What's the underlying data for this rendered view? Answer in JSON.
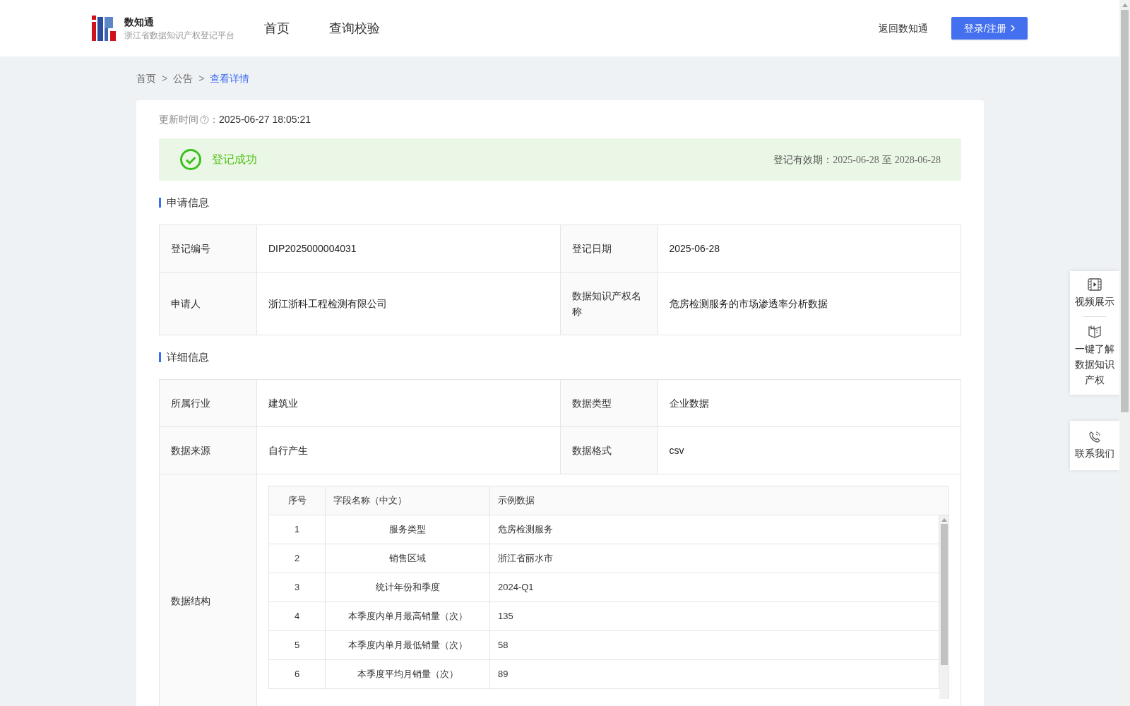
{
  "header": {
    "logo_title": "数知通",
    "logo_subtitle": "浙江省数据知识产权登记平台",
    "nav": [
      {
        "label": "首页"
      },
      {
        "label": "查询校验"
      }
    ],
    "back_link": "返回数知通",
    "login_button": "登录/注册"
  },
  "breadcrumb": [
    {
      "label": "首页",
      "current": false
    },
    {
      "label": "公告",
      "current": false
    },
    {
      "label": "查看详情",
      "current": true
    }
  ],
  "breadcrumb_separator": ">",
  "update": {
    "label": "更新时间",
    "colon": "：",
    "value": "2025-06-27 18:05:21"
  },
  "status": {
    "text": "登记成功",
    "validity_label": "登记有效期：",
    "validity_from": "2025-06-28",
    "validity_sep": "至",
    "validity_to": "2028-06-28"
  },
  "sections": [
    {
      "title": "申请信息",
      "rows": [
        {
          "kind": "pairs",
          "cells": [
            {
              "label": "登记编号",
              "value": "DIP2025000004031"
            },
            {
              "label": "登记日期",
              "value": "2025-06-28"
            }
          ]
        },
        {
          "kind": "pairs",
          "cells": [
            {
              "label": "申请人",
              "value": "浙江浙科工程检测有限公司"
            },
            {
              "label": "数据知识产权名称",
              "value": "危房检测服务的市场渗透率分析数据"
            }
          ]
        }
      ]
    },
    {
      "title": "详细信息",
      "rows": [
        {
          "kind": "pairs",
          "cells": [
            {
              "label": "所属行业",
              "value": "建筑业"
            },
            {
              "label": "数据类型",
              "value": "企业数据"
            }
          ]
        },
        {
          "kind": "pairs",
          "cells": [
            {
              "label": "数据来源",
              "value": "自行产生"
            },
            {
              "label": "数据格式",
              "value": "csv"
            }
          ]
        },
        {
          "kind": "structure",
          "label": "数据结构",
          "columns": [
            "序号",
            "字段名称（中文）",
            "示例数据"
          ],
          "rows": [
            [
              "1",
              "服务类型",
              "危房检测服务"
            ],
            [
              "2",
              "销售区域",
              "浙江省丽水市"
            ],
            [
              "3",
              "统计年份和季度",
              "2024-Q1"
            ],
            [
              "4",
              "本季度内单月最高销量（次）",
              "135"
            ],
            [
              "5",
              "本季度内单月最低销量（次）",
              "58"
            ],
            [
              "6",
              "本季度平均月销量（次）",
              "89"
            ]
          ]
        }
      ]
    }
  ],
  "side_panel": [
    {
      "label": "视频展示",
      "kind": "video"
    },
    {
      "label": "一键了解数据知识产权",
      "kind": "book"
    }
  ],
  "contact": {
    "label": "联系我们"
  }
}
